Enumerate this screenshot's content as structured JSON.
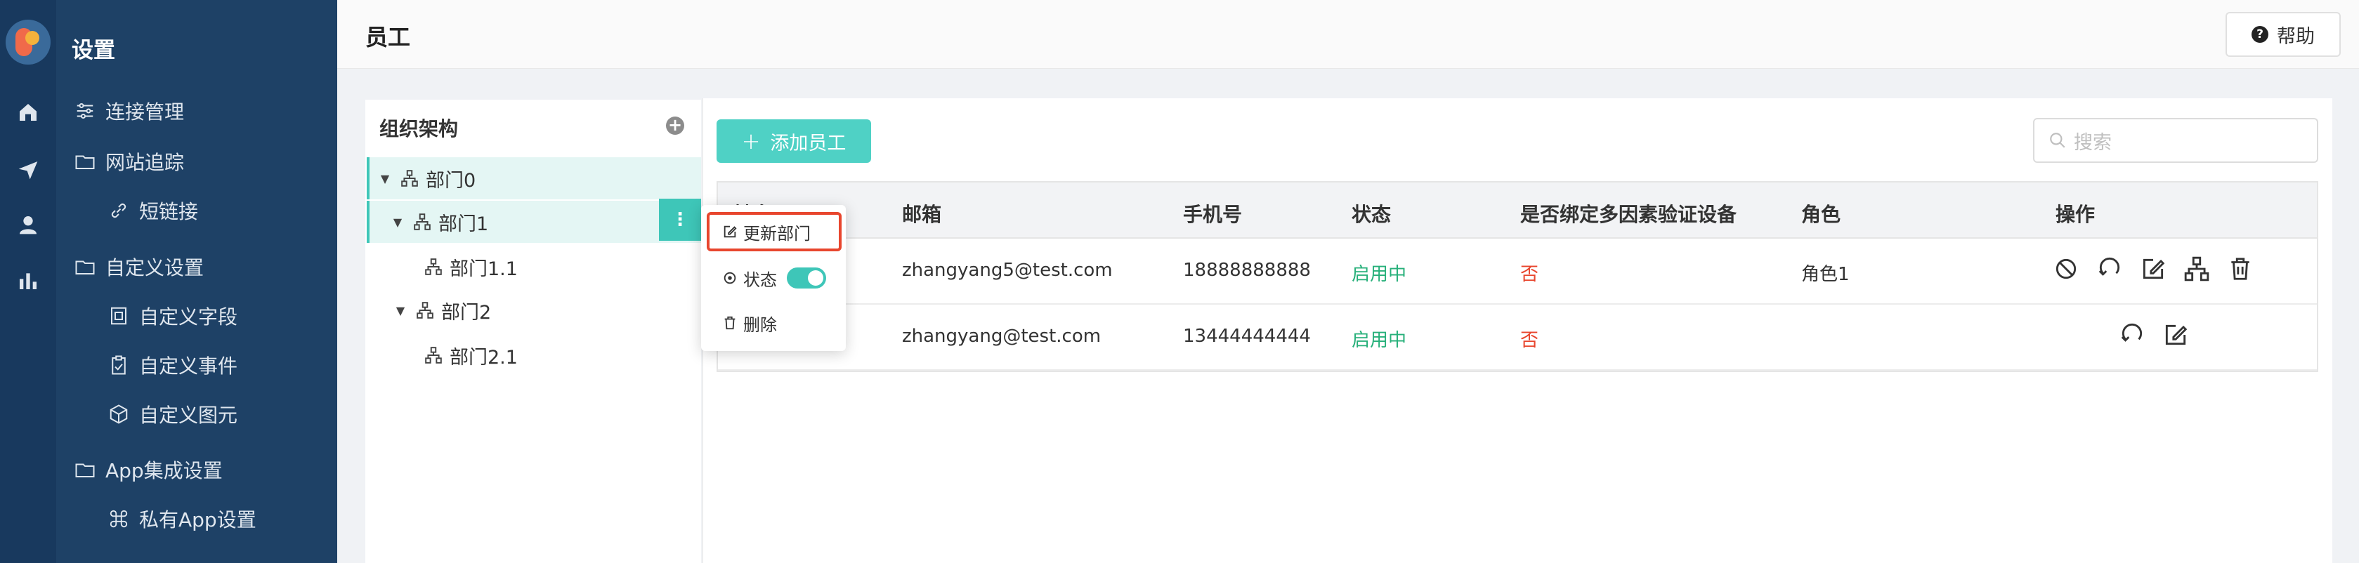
{
  "sidebar": {
    "title": "设置",
    "items": [
      {
        "label": "连接管理",
        "icon": "sliders-icon"
      },
      {
        "label": "网站追踪",
        "icon": "folder-icon"
      },
      {
        "label": "短链接",
        "icon": "link-icon"
      },
      {
        "label": "自定义设置",
        "icon": "folder-icon"
      },
      {
        "label": "自定义字段",
        "icon": "field-icon"
      },
      {
        "label": "自定义事件",
        "icon": "clipboard-icon"
      },
      {
        "label": "自定义图元",
        "icon": "cube-icon"
      },
      {
        "label": "App集成设置",
        "icon": "folder-icon"
      },
      {
        "label": "私有App设置",
        "icon": "command-icon"
      }
    ]
  },
  "header": {
    "title": "员工",
    "help_label": "帮助"
  },
  "org_tree": {
    "title": "组织架构",
    "nodes": [
      {
        "label": "部门0",
        "level": 0,
        "expanded": true
      },
      {
        "label": "部门1",
        "level": 1,
        "expanded": true,
        "selected": true
      },
      {
        "label": "部门1.1",
        "level": 2
      },
      {
        "label": "部门2",
        "level": 1,
        "expanded": true
      },
      {
        "label": "部门2.1",
        "level": 2
      }
    ]
  },
  "toolbar": {
    "add_label": "添加员工",
    "search_placeholder": "搜索"
  },
  "table": {
    "columns": [
      "姓名",
      "邮箱",
      "手机号",
      "状态",
      "是否绑定多因素验证设备",
      "角色",
      "操作"
    ],
    "rows": [
      {
        "email": "zhangyang5@test.com",
        "phone": "18888888888",
        "status": "启用中",
        "mfa": "否",
        "role": "角色1"
      },
      {
        "email": "zhangyang@test.com",
        "phone": "13444444444",
        "status": "启用中",
        "mfa": "否",
        "role": ""
      }
    ]
  },
  "context_menu": {
    "items": [
      {
        "label": "更新部门",
        "icon": "edit-icon"
      },
      {
        "label": "状态",
        "icon": "status-icon",
        "toggle_on": true
      },
      {
        "label": "删除",
        "icon": "trash-icon"
      }
    ]
  },
  "colors": {
    "accent": "#4fd1c5",
    "sidebar": "#1e4166",
    "rail": "#18395e",
    "success": "#27b07a",
    "danger": "#e8462e"
  }
}
